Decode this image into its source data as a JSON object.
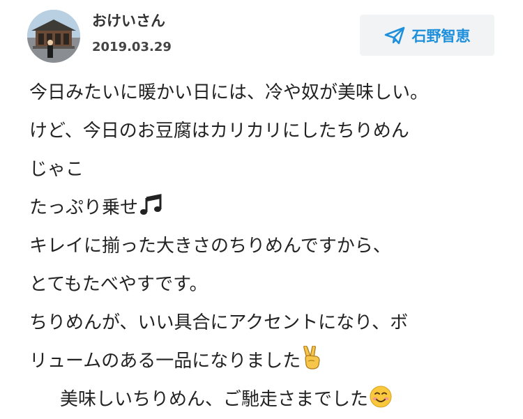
{
  "post": {
    "username": "おけいさん",
    "date": "2019.03.29",
    "recipient": "石野智恵",
    "avatar_icon": "profile-photo",
    "send_icon": "paper-plane-icon",
    "accent_color": "#1d8fdb"
  },
  "message": {
    "lines": [
      {
        "text": "今日みたいに暖かい日には、冷や奴が美味しい。"
      },
      {
        "text": "けど、今日のお豆腐はカリカリにしたちりめん"
      },
      {
        "text": "じゃこ"
      },
      {
        "text": "たっぷり乗せ",
        "emoji": "music-notes-emoji"
      },
      {
        "text": "キレイに揃った大きさのちりめんですから、"
      },
      {
        "text": "とてもたべやすです。"
      },
      {
        "text": "ちりめんが、いい具合にアクセントになり、ボ"
      },
      {
        "text": "リュームのある一品になりました",
        "emoji": "victory-hand-emoji"
      },
      {
        "text": "美味しいちりめん、ご馳走さまでした",
        "emoji": "smiling-face-emoji"
      }
    ]
  }
}
